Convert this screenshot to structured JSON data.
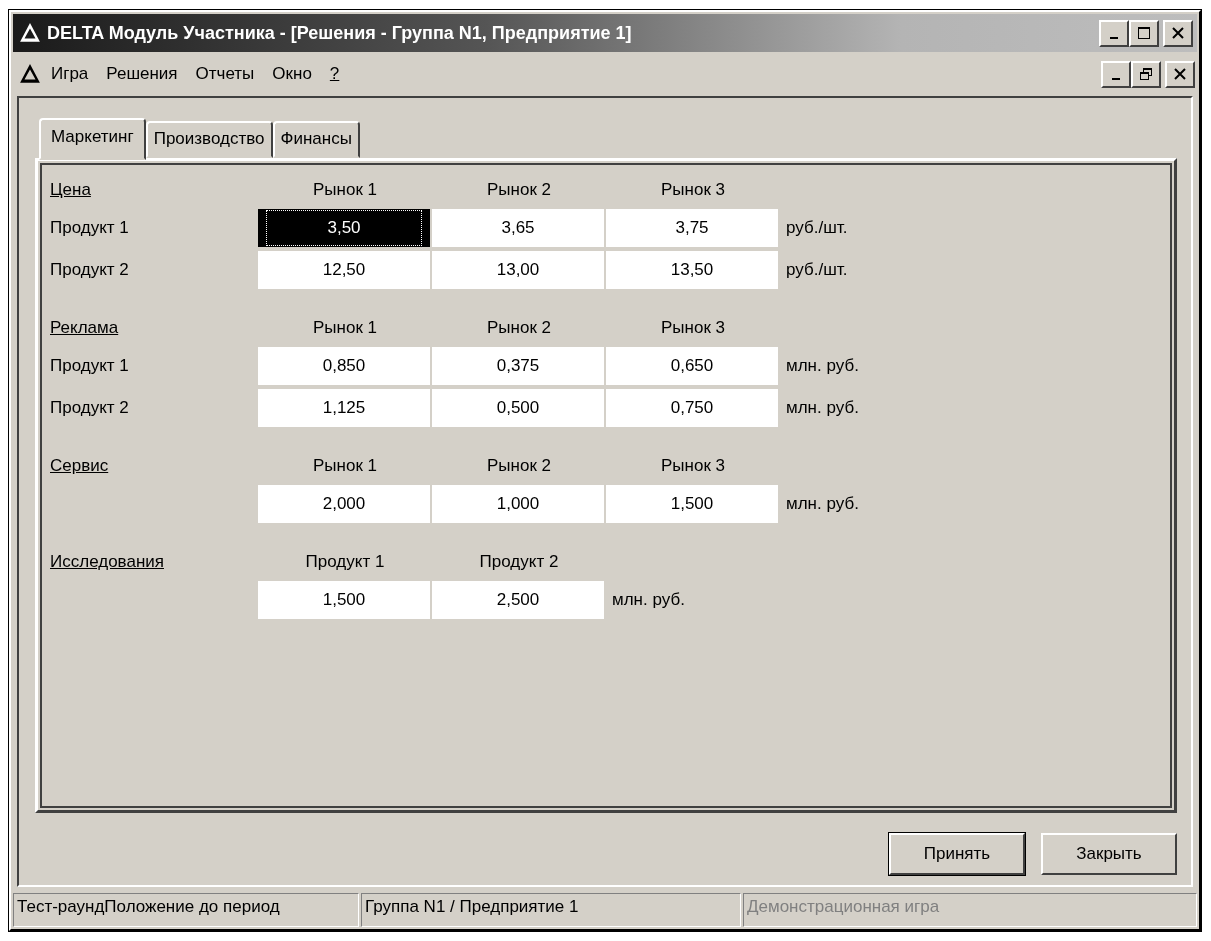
{
  "window": {
    "title": "DELTA Модуль Участника - [Решения - Группа N1, Предприятие 1]"
  },
  "menu": [
    {
      "label": "Игра",
      "underlined": false
    },
    {
      "label": "Решения",
      "underlined": false
    },
    {
      "label": "Отчеты",
      "underlined": false
    },
    {
      "label": "Окно",
      "underlined": false
    },
    {
      "label": "?",
      "underlined": true
    }
  ],
  "tabs": [
    {
      "label": "Маркетинг",
      "selected": true
    },
    {
      "label": "Производство",
      "selected": false
    },
    {
      "label": "Финансы",
      "selected": false
    }
  ],
  "sections": [
    {
      "title": "Цена",
      "headers": [
        "Рынок 1",
        "Рынок 2",
        "Рынок 3"
      ],
      "rows": [
        {
          "label": "Продукт 1",
          "cells": [
            {
              "value": "3,50",
              "selected": true
            },
            {
              "value": "3,65",
              "selected": false
            },
            {
              "value": "3,75",
              "selected": false
            }
          ],
          "unit": "руб./шт."
        },
        {
          "label": "Продукт 2",
          "cells": [
            {
              "value": "12,50",
              "selected": false
            },
            {
              "value": "13,00",
              "selected": false
            },
            {
              "value": "13,50",
              "selected": false
            }
          ],
          "unit": "руб./шт."
        }
      ]
    },
    {
      "title": "Реклама",
      "headers": [
        "Рынок 1",
        "Рынок 2",
        "Рынок 3"
      ],
      "rows": [
        {
          "label": "Продукт 1",
          "cells": [
            {
              "value": "0,850",
              "selected": false
            },
            {
              "value": "0,375",
              "selected": false
            },
            {
              "value": "0,650",
              "selected": false
            }
          ],
          "unit": "млн. руб."
        },
        {
          "label": "Продукт 2",
          "cells": [
            {
              "value": "1,125",
              "selected": false
            },
            {
              "value": "0,500",
              "selected": false
            },
            {
              "value": "0,750",
              "selected": false
            }
          ],
          "unit": "млн. руб."
        }
      ]
    },
    {
      "title": "Сервис",
      "headers": [
        "Рынок 1",
        "Рынок 2",
        "Рынок 3"
      ],
      "rows": [
        {
          "cells": [
            {
              "value": "2,000",
              "selected": false
            },
            {
              "value": "1,000",
              "selected": false
            },
            {
              "value": "1,500",
              "selected": false
            }
          ],
          "unit": "млн. руб."
        }
      ]
    },
    {
      "title": "Исследования",
      "headers": [
        "Продукт 1",
        "Продукт 2"
      ],
      "rows": [
        {
          "cells": [
            {
              "value": "1,500",
              "selected": false
            },
            {
              "value": "2,500",
              "selected": false
            }
          ],
          "unit": "млн. руб."
        }
      ]
    }
  ],
  "buttons": [
    {
      "label": "Принять",
      "default": true
    },
    {
      "label": "Закрыть",
      "default": false
    }
  ],
  "status_bar": [
    {
      "text": "Тест-раундПоложение до период",
      "disabled": false
    },
    {
      "text": "Группа N1 / Предприятие 1",
      "disabled": false
    },
    {
      "text": "Демонстрационная игра",
      "disabled": true
    }
  ]
}
